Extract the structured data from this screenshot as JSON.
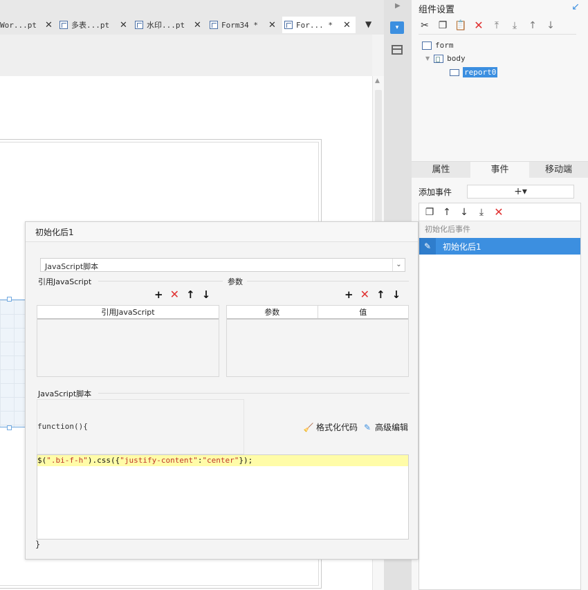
{
  "tabs": [
    {
      "label": "Wor...pt",
      "close": "✕"
    },
    {
      "label": "多表...pt",
      "close": "✕"
    },
    {
      "label": "水印...pt",
      "close": "✕"
    },
    {
      "label": "Form34 *",
      "close": "✕"
    },
    {
      "label": "For... *",
      "close": "✕"
    }
  ],
  "panel": {
    "title": "组件设置",
    "tree": {
      "form": "form",
      "body": "body",
      "report": "report0"
    },
    "tabs": [
      "属性",
      "事件",
      "移动端"
    ],
    "add_event_label": "添加事件",
    "add_event_btn": "+▾",
    "event_group": "初始化后事件",
    "event_item": "初始化后1"
  },
  "dialog": {
    "title": "初始化后1",
    "script_type": "JavaScript脚本",
    "ref_js_label": "引用JavaScript",
    "params_label": "参数",
    "ref_js_col": "引用JavaScript",
    "params_col": "参数",
    "value_col": "值",
    "script_section": "JavaScript脚本",
    "fn_header": "function(){",
    "format_btn": "格式化代码",
    "advanced_btn": "高级编辑",
    "code_line_prefix": "$(",
    "code_selector": "\".bi-f-h\"",
    "code_mid": ").css({",
    "code_key": "\"justify-content\"",
    "code_colon": ":",
    "code_val": "\"center\"",
    "code_end": "});",
    "close_brace": "}"
  }
}
